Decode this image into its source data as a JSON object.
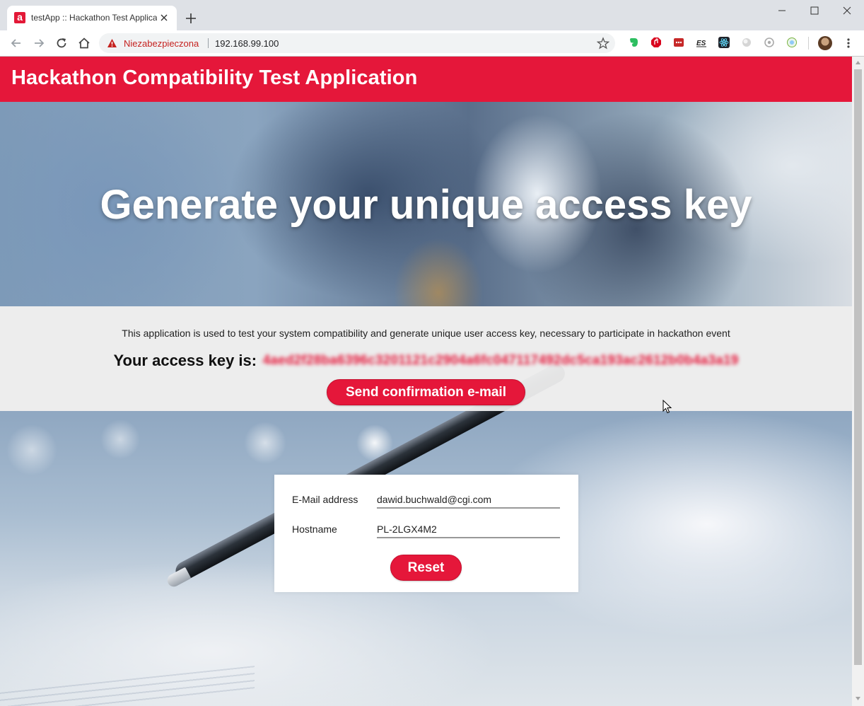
{
  "browser": {
    "tab_title": "testApp :: Hackathon Test Application",
    "favicon_letter": "a",
    "security_label": "Niezabezpieczona",
    "url": "192.168.99.100",
    "extensions": [
      "evernote-icon",
      "adblock-icon",
      "ublock-icon",
      "es-icon",
      "react-devtools-icon",
      "circle-extension-icon",
      "gear-extension-icon",
      "globe-extension-icon"
    ]
  },
  "app": {
    "title": "Hackathon Compatibility Test Application",
    "hero_title": "Generate your unique access key",
    "description": "This application is used to test your system compatibility and generate unique user access key, necessary to participate in hackathon event",
    "access_key_label": "Your access key is:",
    "access_key_value": "4aed2f28ba6396c3201121c2904a6fc047117492dc5ca193ac2612b0b4a3a19",
    "send_button": "Send confirmation e-mail"
  },
  "form": {
    "email_label": "E-Mail address",
    "email_value": "dawid.buchwald@cgi.com",
    "hostname_label": "Hostname",
    "hostname_value": "PL-2LGX4M2",
    "reset_button": "Reset"
  },
  "colors": {
    "brand_red": "#e5173a",
    "insecure_red": "#c5221f"
  }
}
